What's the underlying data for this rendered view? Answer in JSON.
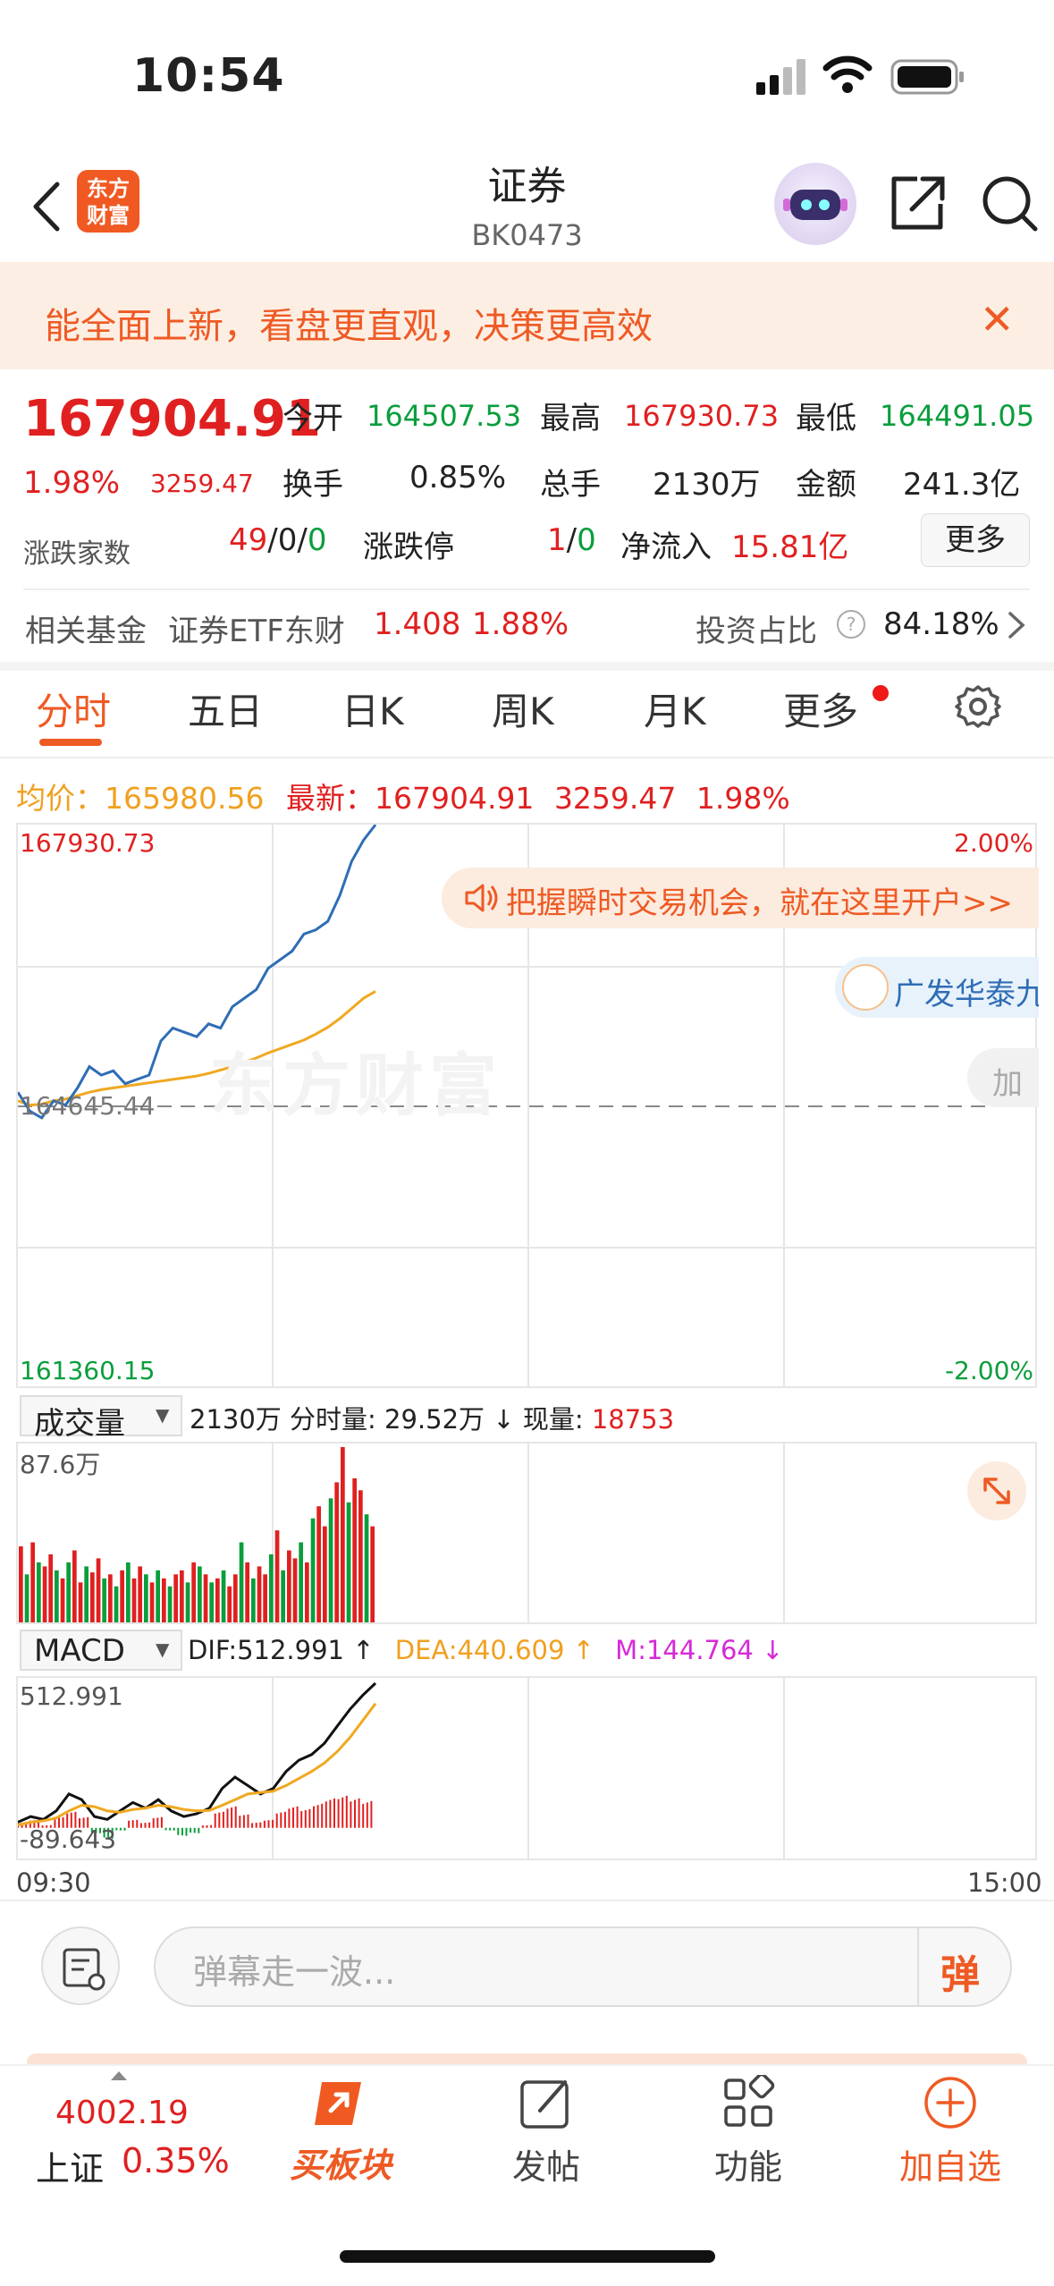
{
  "status_bar": {
    "time": "10:54"
  },
  "header": {
    "logo_text_1": "东方",
    "logo_text_2": "财富",
    "title": "证券",
    "code": "BK0473"
  },
  "notice": {
    "text": "能全面上新，看盘更直观，决策更高效",
    "close": "✕"
  },
  "quote": {
    "price": "167904.91",
    "change_pct": "1.98%",
    "change_amt": "3259.47",
    "open_label": "今开",
    "open": "164507.53",
    "high_label": "最高",
    "high": "167930.73",
    "low_label": "最低",
    "low": "164491.05",
    "turnover_label": "换手",
    "turnover": "0.85%",
    "volume_label": "总手",
    "volume": "2130万",
    "amount_label": "金额",
    "amount": "241.3亿",
    "breadth_label": "涨跌家数",
    "breadth_up": "49",
    "breadth_sep1": "/",
    "breadth_flat": "0",
    "breadth_sep2": "/",
    "breadth_down": "0",
    "limit_label": "涨跌停",
    "limit_up": "1",
    "limit_sep": "/",
    "limit_down": "0",
    "netflow_label": "净流入",
    "netflow": "15.81亿",
    "more": "更多"
  },
  "fund": {
    "label": "相关基金",
    "name": "证券ETF东财",
    "price": "1.408",
    "pct": "1.88%",
    "ratio_label": "投资占比",
    "help": "?",
    "ratio": "84.18%"
  },
  "tabs": [
    "分时",
    "五日",
    "日K",
    "周K",
    "月K",
    "更多"
  ],
  "price_line": {
    "avg_label": "均价：",
    "avg": "165980.56",
    "last_label": "最新：",
    "last": "167904.91",
    "chg": "3259.47",
    "pct": "1.98%"
  },
  "main_chart": {
    "top_left": "167930.73",
    "top_right": "2.00%",
    "mid_left": "164645.44",
    "bottom_left": "161360.15",
    "bottom_right": "-2.00%",
    "ad_text": "把握瞬时交易机会，就在这里开户>>",
    "broker_text": "广发华泰九",
    "add_text": "加",
    "watermark": "东方财富"
  },
  "volume_chart": {
    "selector": "成交量",
    "total": "2130万",
    "tick_label": "分时量:",
    "tick_value": "29.52万",
    "arrow": "↓",
    "now_label": "现量:",
    "now_value": "18753",
    "max_label": "87.6万"
  },
  "macd_chart": {
    "selector": "MACD",
    "dif": "DIF:512.991 ↑",
    "dea": "DEA:440.609 ↑",
    "m": "M:144.764 ↓",
    "max_label": "512.991",
    "min_label": "-89.643"
  },
  "time_axis": {
    "start": "09:30",
    "end": "15:00"
  },
  "comment": {
    "placeholder": "弹幕走一波...",
    "button": "弹"
  },
  "bottom_nav": {
    "index_value": "4002.19",
    "index_name": "上证",
    "index_pct": "0.35%",
    "items": [
      "买板块",
      "发帖",
      "功能",
      "加自选"
    ]
  },
  "colors": {
    "up": "#e02020",
    "down": "#0a9e3c",
    "brand": "#ee5a24",
    "price_line": "#2f6db5",
    "avg_line": "#f0a820"
  },
  "chart_data": [
    {
      "type": "line",
      "title": "",
      "ylim": [
        161360.15,
        167930.73
      ],
      "series": [
        {
          "name": "最新",
          "values": [
            164800,
            164580,
            164500,
            164700,
            164650,
            164850,
            165100,
            165000,
            165050,
            164900,
            164950,
            165000,
            165400,
            165550,
            165500,
            165450,
            165600,
            165550,
            165800,
            165900,
            166000,
            166250,
            166350,
            166450,
            166650,
            166700,
            166800,
            167100,
            167500,
            167750,
            167930
          ]
        },
        {
          "name": "均价",
          "values": [
            164700,
            164650,
            164660,
            164700,
            164720,
            164760,
            164800,
            164830,
            164850,
            164870,
            164890,
            164910,
            164930,
            164950,
            164970,
            164990,
            165020,
            165060,
            165100,
            165150,
            165200,
            165260,
            165310,
            165360,
            165410,
            165480,
            165560,
            165660,
            165780,
            165900,
            165980
          ]
        }
      ]
    },
    {
      "type": "bar",
      "title": "成交量",
      "ylim": [
        0,
        87.6
      ],
      "values": [
        38,
        24,
        40,
        30,
        28,
        34,
        26,
        22,
        30,
        36,
        20,
        28,
        25,
        32,
        22,
        24,
        18,
        26,
        30,
        22,
        28,
        24,
        20,
        26,
        22,
        18,
        24,
        26,
        20,
        30,
        28,
        24,
        20,
        22,
        26,
        18,
        24,
        40,
        30,
        22,
        28,
        24,
        34,
        46,
        26,
        36,
        32,
        40,
        30,
        52,
        58,
        48,
        62,
        70,
        87.6,
        60,
        72,
        66,
        54,
        48
      ],
      "up": [
        true,
        false,
        true,
        false,
        true,
        true,
        false,
        true,
        false,
        true,
        true,
        false,
        true,
        true,
        false,
        true,
        false,
        true,
        false,
        true,
        true,
        false,
        true,
        false,
        true,
        false,
        true,
        true,
        false,
        true,
        false,
        true,
        false,
        true,
        false,
        true,
        true,
        false,
        true,
        false,
        true,
        true,
        false,
        true,
        false,
        true,
        true,
        false,
        true,
        false,
        true,
        true,
        false,
        true,
        true,
        false,
        true,
        true,
        false,
        true
      ]
    },
    {
      "type": "line",
      "title": "MACD",
      "ylim": [
        -89.643,
        512.991
      ],
      "series": [
        {
          "name": "DIF",
          "values": [
            20,
            40,
            30,
            60,
            120,
            100,
            40,
            30,
            60,
            90,
            70,
            100,
            60,
            40,
            50,
            70,
            140,
            180,
            150,
            120,
            140,
            200,
            240,
            260,
            300,
            360,
            420,
            470,
            512.991
          ]
        },
        {
          "name": "DEA",
          "values": [
            10,
            20,
            25,
            35,
            60,
            80,
            75,
            60,
            55,
            65,
            70,
            80,
            75,
            65,
            60,
            62,
            80,
            100,
            120,
            125,
            130,
            150,
            175,
            200,
            230,
            270,
            320,
            380,
            440.609
          ]
        }
      ],
      "histogram": [
        20,
        30,
        10,
        40,
        60,
        40,
        -20,
        -40,
        -10,
        30,
        20,
        40,
        -10,
        -30,
        -20,
        10,
        60,
        80,
        50,
        20,
        30,
        60,
        80,
        70,
        90,
        110,
        120,
        110,
        100
      ]
    }
  ]
}
